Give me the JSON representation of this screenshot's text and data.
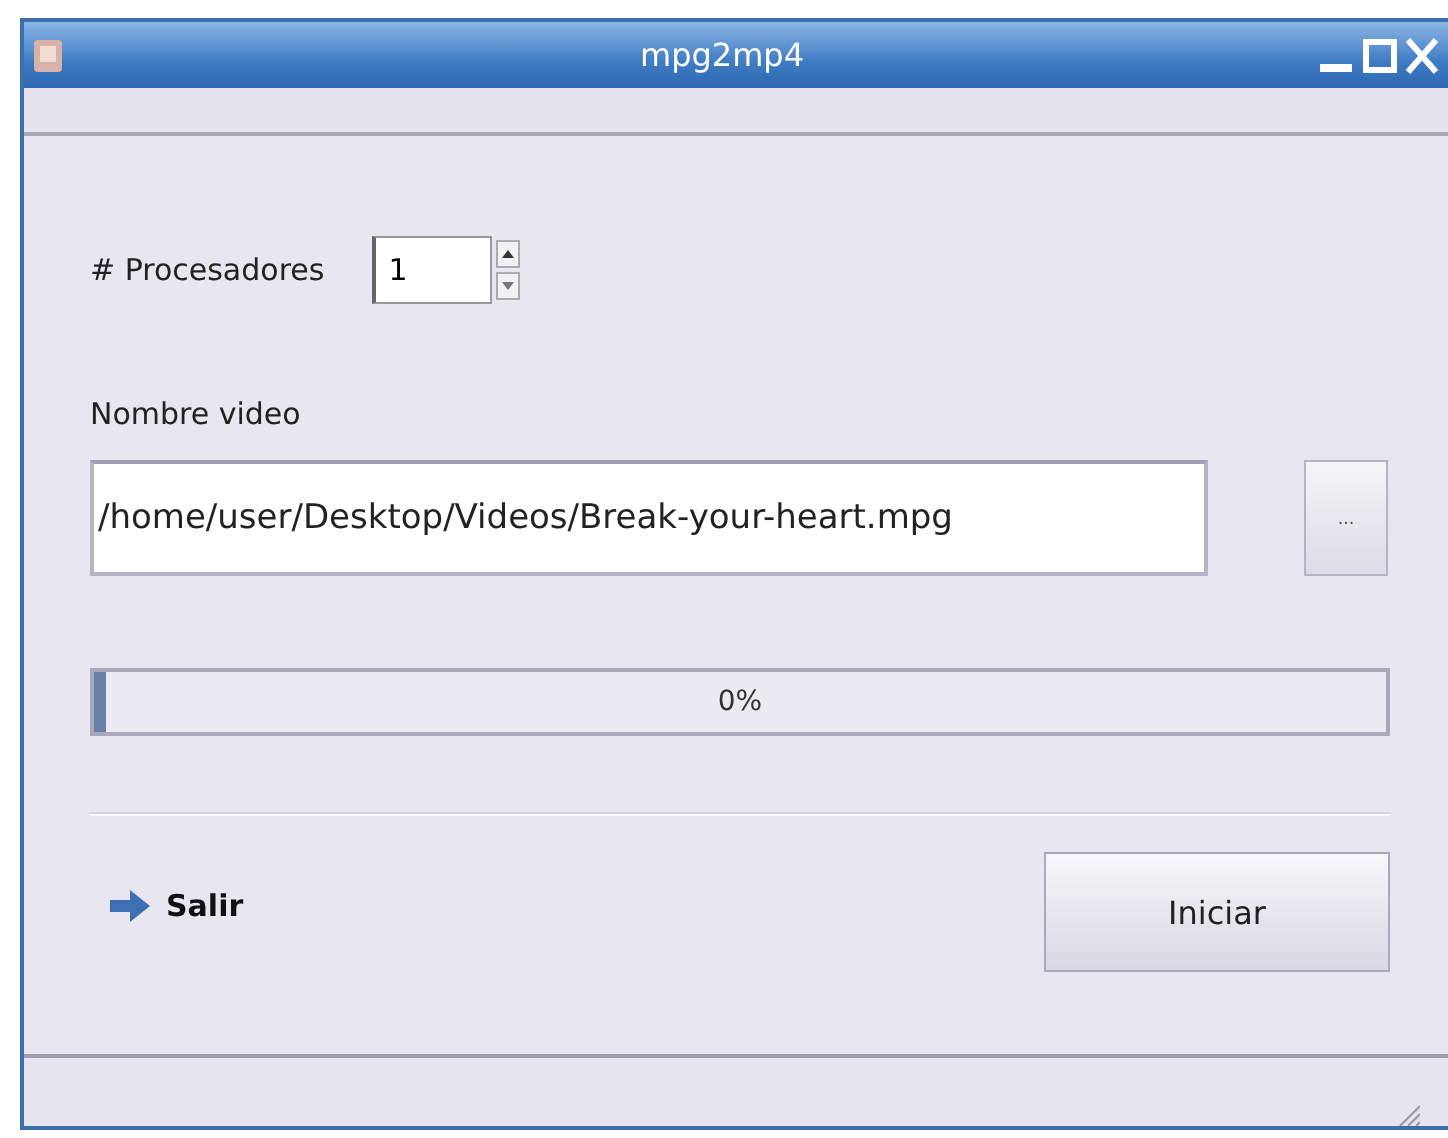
{
  "window": {
    "title": "mpg2mp4"
  },
  "processors": {
    "label": "# Procesadores",
    "value": "1"
  },
  "video": {
    "label": "Nombre video",
    "value": "/home/user/Desktop/Videos/Break-your-heart.mpg",
    "browse_button": "..."
  },
  "progress": {
    "level": 0.01,
    "reading": "0%"
  },
  "exit_link": {
    "label": "Salir"
  },
  "start_button": {
    "label": "Iniciar"
  }
}
